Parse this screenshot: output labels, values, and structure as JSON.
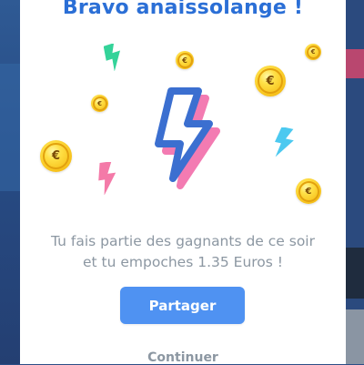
{
  "dialog": {
    "title": "Bravo anaissolange !",
    "message_line1": "Tu fais partie des gagnants de ce soir",
    "message_line2": "et tu empoches 1.35 Euros !",
    "share_label": "Partager",
    "continue_label": "Continuer",
    "coin_symbol": "€"
  },
  "colors": {
    "title": "#2b6fd6",
    "share_button": "#4f92f2",
    "muted_text": "#8c97a2",
    "bolt_main": "#3b6fd0",
    "bolt_shadow": "#f37bb2",
    "bolt_green": "#34d399",
    "bolt_cyan": "#4cc9f0",
    "bolt_pink": "#f47aa8",
    "coin": "#f7c21c"
  },
  "icons": [
    "lightning-bolt-icon",
    "euro-coin-icon"
  ]
}
